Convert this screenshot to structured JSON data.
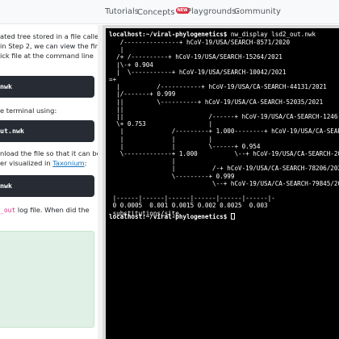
{
  "navbar": {
    "items": [
      {
        "label": "Tutorials"
      },
      {
        "label": "Concepts",
        "badge": "NEW"
      },
      {
        "label": "Playgrounds",
        "caret": "▾"
      },
      {
        "label": "Community"
      }
    ]
  },
  "left": {
    "p1_lines": [
      "ated tree stored in a file called",
      "in Step 2, we can view the first",
      "ick file at the command line"
    ],
    "code1": "nwk",
    "p2": "e terminal using:",
    "code2": "ut.nwk",
    "p3_lines": [
      "nload the file so that it can be",
      "er visualized in "
    ],
    "p3_link": "Taxonium",
    "p3_after": ":",
    "code3": "nwk",
    "p4_code": "_out",
    "p4_text": " log file. When did the"
  },
  "terminal": {
    "prompt": "localhost:~/viral-phylogenetics$",
    "command": " nw_display lsd2_out.nwk",
    "tree_lines": [
      "   /---------------+ hCoV-19/USA/SEARCH-8571/2020",
      "   |",
      "  /+ /----------+ hCoV-19/USA/SEARCH-15264/2021",
      "  |\\-+ 0.904",
      "  |  \\-----------+ hCoV-19/USA/SEARCH-10042/2021",
      "=+",
      "  |          /-----------+ hCoV-19/USA/CA-SEARCH-44131/2021",
      "  |/-------+ 0.999",
      "  ||         \\----------+ hCoV-19/USA/CA-SEARCH-52035/2021",
      "  ||",
      "  ||                       /------+ hCoV-19/USA/CA-SEARCH-1246",
      "  \\+ 0.753                 |",
      "   |             /---------+ 1.000--------+ hCoV-19/USA/CA-SEAR",
      "   |             |         |",
      "   |             |         \\------+ 0.954",
      "   \\-------------+ 1.000          \\--+ hCoV-19/USA/CA-SEARCH-203",
      "                 |",
      "                 |          /-+ hCoV-19/USA/CA-SEARCH-78206/2022",
      "                 \\---------+ 0.999",
      "                            \\--+ hCoV-19/USA/CA-SEARCH-79845/2022",
      "",
      " |------|------|------|------|------|------|-",
      " 0 0.0005  0.001 0.0015 0.002 0.0025  0.003",
      " substitutions/site"
    ],
    "final_prompt": "localhost:~/viral-phylogenetics$ "
  }
}
